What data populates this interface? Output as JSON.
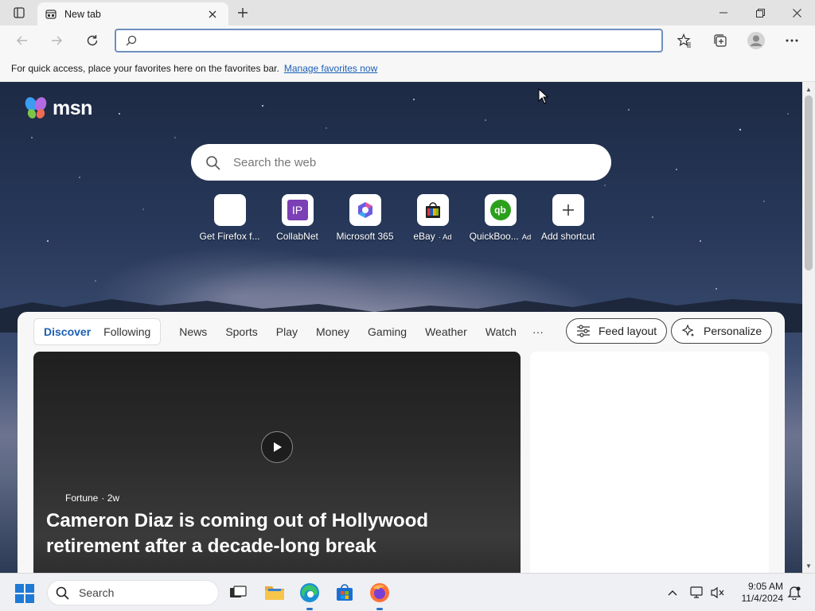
{
  "browser": {
    "tab_title": "New tab",
    "address_placeholder": "",
    "favorites_bar_message": "For quick access, place your favorites here on the favorites bar.",
    "favorites_bar_link": "Manage favorites now"
  },
  "msn": {
    "logo_text": "msn",
    "search_placeholder": "Search the web",
    "shortcuts": [
      {
        "label": "Get Firefox f...",
        "ad": "",
        "icon": "firefox-download-icon"
      },
      {
        "label": "CollabNet",
        "ad": "",
        "icon": "collabnet-ip-icon",
        "icon_text": "IP"
      },
      {
        "label": "Microsoft 365",
        "ad": "",
        "icon": "microsoft-365-icon"
      },
      {
        "label": "eBay",
        "ad": "· Ad",
        "icon": "ebay-bag-icon"
      },
      {
        "label": "QuickBoo...",
        "ad": "Ad",
        "icon": "quickbooks-icon",
        "icon_text": "qb"
      },
      {
        "label": "Add shortcut",
        "ad": "",
        "icon": "plus-icon"
      }
    ],
    "feed_nav": {
      "segment": [
        "Discover",
        "Following"
      ],
      "items": [
        "News",
        "Sports",
        "Play",
        "Money",
        "Gaming",
        "Weather",
        "Watch"
      ],
      "more": "···",
      "feed_layout": "Feed layout",
      "personalize": "Personalize"
    },
    "hero": {
      "source": "Fortune",
      "age": "· 2w",
      "headline": "Cameron Diaz is coming out of Hollywood retirement after a decade-long break"
    }
  },
  "taskbar": {
    "search_label": "Search",
    "time": "9:05 AM",
    "date": "11/4/2024"
  },
  "colors": {
    "accent": "#1a5fb4",
    "address_border": "#6f8fbe",
    "taskbar_active": "#2a70c6"
  }
}
